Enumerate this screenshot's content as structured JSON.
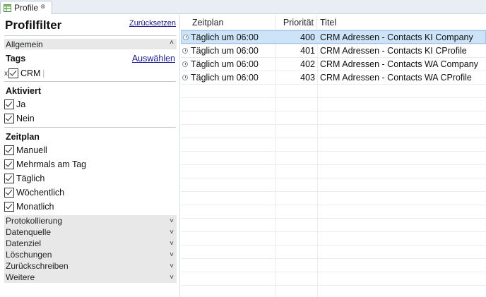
{
  "tab": {
    "label": "Profile",
    "close": "⊗",
    "icon": "profile-grid-icon"
  },
  "filter": {
    "title": "Profilfilter",
    "reset_label": "Zurücksetzen",
    "general_section": "Allgemein",
    "tags": {
      "title": "Tags",
      "choose_label": "Auswählen",
      "items": [
        {
          "remove": "x",
          "label": "CRM",
          "checked": true
        }
      ]
    },
    "active": {
      "title": "Aktiviert",
      "options": [
        {
          "label": "Ja",
          "checked": true
        },
        {
          "label": "Nein",
          "checked": true
        }
      ]
    },
    "schedule": {
      "title": "Zeitplan",
      "options": [
        {
          "label": "Manuell",
          "checked": true
        },
        {
          "label": "Mehrmals am Tag",
          "checked": true
        },
        {
          "label": "Täglich",
          "checked": true
        },
        {
          "label": "Wöchentlich",
          "checked": true
        },
        {
          "label": "Monatlich",
          "checked": true
        }
      ]
    },
    "collapsed_sections": [
      "Protokollierung",
      "Datenquelle",
      "Datenziel",
      "Löschungen",
      "Zurückschreiben",
      "Weitere"
    ]
  },
  "table": {
    "columns": [
      "Zeitplan",
      "Priorität",
      "Titel"
    ],
    "rows": [
      {
        "schedule": "Täglich um 06:00",
        "priority": "400",
        "title": "CRM Adressen - Contacts KI Company",
        "selected": true
      },
      {
        "schedule": "Täglich um 06:00",
        "priority": "401",
        "title": "CRM Adressen - Contacts KI CProfile",
        "selected": false
      },
      {
        "schedule": "Täglich um 06:00",
        "priority": "402",
        "title": "CRM Adressen - Contacts WA Company",
        "selected": false
      },
      {
        "schedule": "Täglich um 06:00",
        "priority": "403",
        "title": "CRM Adressen - Contacts WA CProfile",
        "selected": false
      }
    ]
  },
  "colors": {
    "accent_link": "#1a1a8c",
    "selection": "#cde3f7",
    "section_bg": "#e8e8e8"
  }
}
